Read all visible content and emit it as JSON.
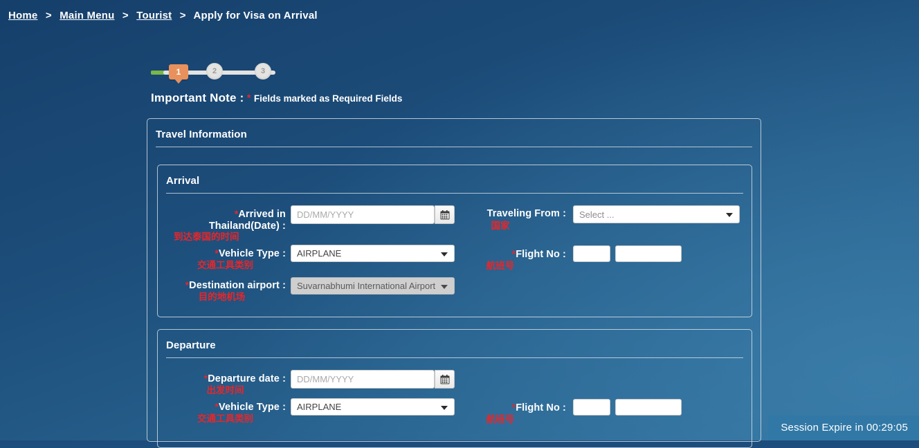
{
  "breadcrumb": {
    "items": [
      {
        "label": "Home",
        "link": true
      },
      {
        "label": "Main Menu",
        "link": true
      },
      {
        "label": "Tourist",
        "link": true
      },
      {
        "label": "Apply for Visa on Arrival",
        "link": false
      }
    ],
    "separator": ">"
  },
  "stepper": {
    "current": "1",
    "steps": [
      {
        "number": "1",
        "state": "active"
      },
      {
        "number": "2",
        "state": "inactive"
      },
      {
        "number": "3",
        "state": "inactive"
      }
    ],
    "active_color": "#e8915c",
    "progress_color": "#7ab648",
    "track_color": "#e3e3e1"
  },
  "note": {
    "title": "Important Note :",
    "asterisk": "*",
    "text": "Fields marked as Required Fields",
    "required_color": "#e8262a"
  },
  "panel": {
    "title": "Travel Information"
  },
  "arrival": {
    "legend": "Arrival",
    "arrived_date": {
      "label": "Arrived in Thailand(Date) :",
      "label_line1": "Arrived in",
      "label_line2": "Thailand(Date) :",
      "cn": "到达泰国的时间",
      "required": "*",
      "placeholder": "DD/MM/YYYY",
      "value": "",
      "calendar_icon": "calendar-icon"
    },
    "vehicle_type": {
      "label": "Vehicle Type :",
      "cn": "交通工具类别",
      "required": "*",
      "value": "AIRPLANE"
    },
    "destination_airport": {
      "label": "Destination airport :",
      "cn": "目的地机场",
      "required": "*",
      "value": "Suvarnabhumi International Airport",
      "disabled": true
    },
    "traveling_from": {
      "label": "Traveling From :",
      "cn": "国家",
      "required": "",
      "placeholder": "Select ...",
      "value": ""
    },
    "flight_no": {
      "label": "Flight No :",
      "cn": "航班号",
      "required": "*",
      "prefix_value": "",
      "number_value": ""
    }
  },
  "departure": {
    "legend": "Departure",
    "departure_date": {
      "label": "Departure date :",
      "cn": "出发时间",
      "required": "*",
      "placeholder": "DD/MM/YYYY",
      "value": "",
      "calendar_icon": "calendar-icon"
    },
    "vehicle_type": {
      "label": "Vehicle Type :",
      "cn": "交通工具类别",
      "required": "*",
      "value": "AIRPLANE"
    },
    "flight_no": {
      "label": "Flight No :",
      "cn": "航班号",
      "required": "*",
      "prefix_value": "",
      "number_value": ""
    }
  },
  "session": {
    "text": "Session Expire in 00:29:05",
    "background": "#3178a6"
  }
}
